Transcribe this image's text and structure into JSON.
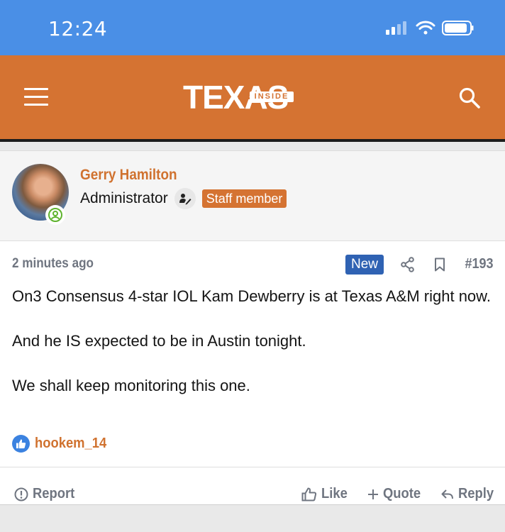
{
  "status_bar": {
    "time": "12:24"
  },
  "header": {
    "logo_main": "TEXAS",
    "logo_sub": "INSIDE"
  },
  "post": {
    "author": "Gerry Hamilton",
    "role": "Administrator",
    "staff_badge": "Staff member",
    "time_ago": "2 minutes ago",
    "new_badge": "New",
    "post_number": "#193",
    "body": [
      "On3 Consensus 4-star IOL Kam Dewberry is at Texas A&M right now.",
      "And he IS expected to be in Austin tonight.",
      "We shall keep monitoring this one."
    ],
    "reactions": {
      "user": "hookem_14"
    },
    "actions": {
      "report": "Report",
      "like": "Like",
      "quote": "Quote",
      "reply": "Reply"
    }
  },
  "colors": {
    "header": "#d57332",
    "status_bar": "#4a8fe6",
    "new_badge": "#2f62b3",
    "accent_text": "#d0722f"
  },
  "icons": [
    "menu-icon",
    "search-icon",
    "online-status-icon",
    "staff-pen-icon",
    "share-icon",
    "bookmark-icon",
    "like-reaction-icon",
    "report-icon",
    "thumbs-up-icon",
    "plus-icon",
    "reply-arrow-icon"
  ]
}
